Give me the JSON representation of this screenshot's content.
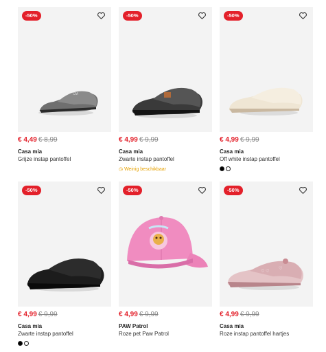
{
  "products": [
    {
      "discount": "-50%",
      "price": "€ 4,49",
      "old_price": "€ 8,99",
      "brand": "Casa mia",
      "name": "Grijze instap pantoffel",
      "image": "grey-slipper-image"
    },
    {
      "discount": "-50%",
      "price": "€ 4,99",
      "old_price": "€ 9,99",
      "brand": "Casa mia",
      "name": "Zwarte instap pantoffel",
      "stock": "Weinig beschikbaar",
      "image": "dark-grey-slipper-image"
    },
    {
      "discount": "-50%",
      "price": "€ 4,99",
      "old_price": "€ 9,99",
      "brand": "Casa mia",
      "name": "Off white instap pantoffel",
      "swatches": [
        "black",
        "white"
      ],
      "image": "off-white-slipper-image"
    },
    {
      "discount": "-50%",
      "price": "€ 4,99",
      "old_price": "€ 9,99",
      "brand": "Casa mia",
      "name": "Zwarte instap pantoffel",
      "swatches": [
        "black",
        "white"
      ],
      "image": "black-slipper-image"
    },
    {
      "discount": "-50%",
      "price": "€ 4,99",
      "old_price": "€ 9,99",
      "brand": "PAW Patrol",
      "name": "Roze pet Paw Patrol",
      "image": "pink-cap-image"
    },
    {
      "discount": "-50%",
      "price": "€ 4,99",
      "old_price": "€ 9,99",
      "brand": "Casa mia",
      "name": "Roze instap pantoffel hartjes",
      "image": "pink-hearts-slipper-image"
    }
  ],
  "colors": {
    "accent": "#e3202a",
    "stock": "#e6a100"
  }
}
